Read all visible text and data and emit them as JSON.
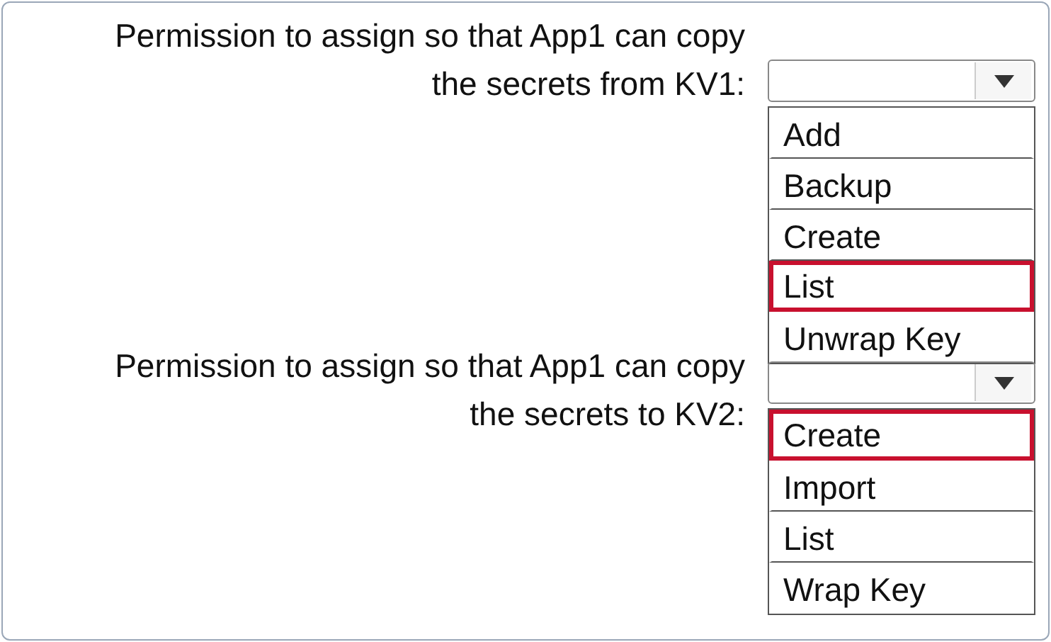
{
  "questions": [
    {
      "label_lines": [
        "Permission to assign so that App1 can copy",
        "the secrets from KV1:"
      ],
      "options": [
        {
          "label": "Add",
          "selected": false
        },
        {
          "label": "Backup",
          "selected": false
        },
        {
          "label": "Create",
          "selected": false
        },
        {
          "label": "List",
          "selected": true
        },
        {
          "label": "Unwrap Key",
          "selected": false
        }
      ]
    },
    {
      "label_lines": [
        "Permission to assign so that App1 can copy",
        "the secrets to KV2:"
      ],
      "options": [
        {
          "label": "Create",
          "selected": true
        },
        {
          "label": "Import",
          "selected": false
        },
        {
          "label": "List",
          "selected": false
        },
        {
          "label": "Wrap Key",
          "selected": false
        }
      ]
    }
  ]
}
